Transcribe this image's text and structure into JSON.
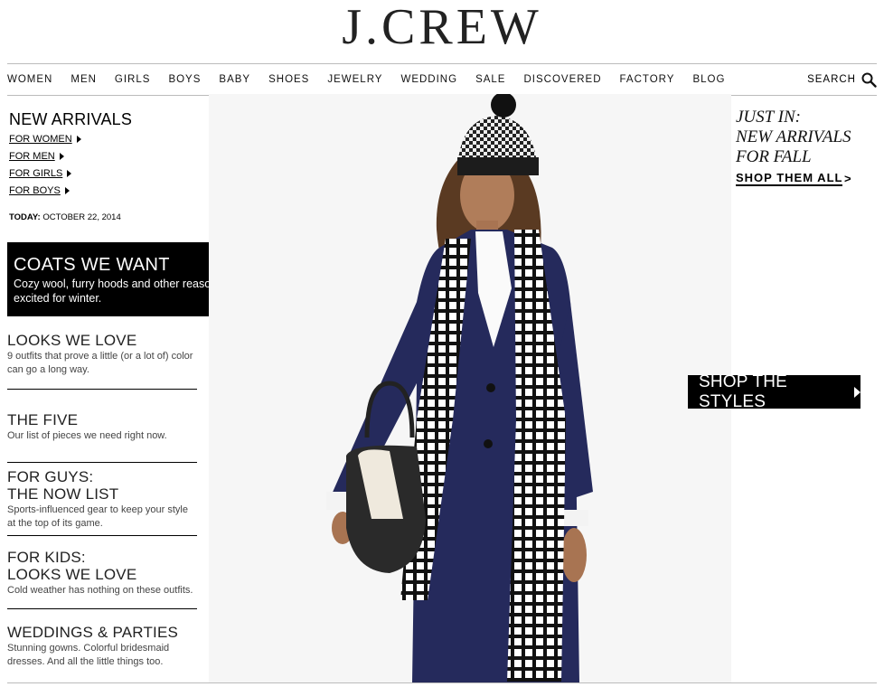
{
  "brand": {
    "logo": "J.CREW"
  },
  "nav": {
    "items": [
      "WOMEN",
      "MEN",
      "GIRLS",
      "BOYS",
      "BABY",
      "SHOES",
      "JEWELRY",
      "WEDDING",
      "SALE",
      "DISCOVERED",
      "FACTORY",
      "BLOG"
    ],
    "search_label": "SEARCH"
  },
  "sidebar": {
    "new_arrivals_title": "NEW ARRIVALS",
    "links": [
      "FOR WOMEN",
      "FOR MEN",
      "FOR GIRLS",
      "FOR BOYS"
    ],
    "today_label": "TODAY:",
    "today_date": "OCTOBER 22, 2014",
    "coats": {
      "title": "COATS WE WANT",
      "desc": "Cozy wool, furry hoods and other reasons to get excited for winter."
    },
    "features": [
      {
        "title": "LOOKS WE LOVE",
        "desc": "9 outfits that prove a little (or a lot of) color can go a long way."
      },
      {
        "title": "THE FIVE",
        "desc": "Our list of pieces we need right now."
      },
      {
        "title": "FOR GUYS:\nTHE NOW LIST",
        "title_line1": "FOR GUYS:",
        "title_line2": "THE NOW LIST",
        "desc": "Sports-influenced gear to keep your style at the top of its game."
      },
      {
        "title_line1": "FOR KIDS:",
        "title_line2": "LOOKS WE LOVE",
        "desc": "Cold weather has nothing on these outfits."
      },
      {
        "title": "WEDDINGS & PARTIES",
        "desc": "Stunning gowns. Colorful bridesmaid dresses. And all the little things too."
      }
    ]
  },
  "promo": {
    "just_in_line1": "JUST IN:",
    "just_in_line2": "NEW ARRIVALS",
    "just_in_line3": "FOR FALL",
    "shop_all": "SHOP THEM ALL",
    "shop_all_arrow": ">",
    "shop_styles": "SHOP THE STYLES"
  },
  "colors": {
    "navy_coat": "#252a5c",
    "accent_black": "#000000",
    "hero_bg": "#f6f6f6"
  }
}
